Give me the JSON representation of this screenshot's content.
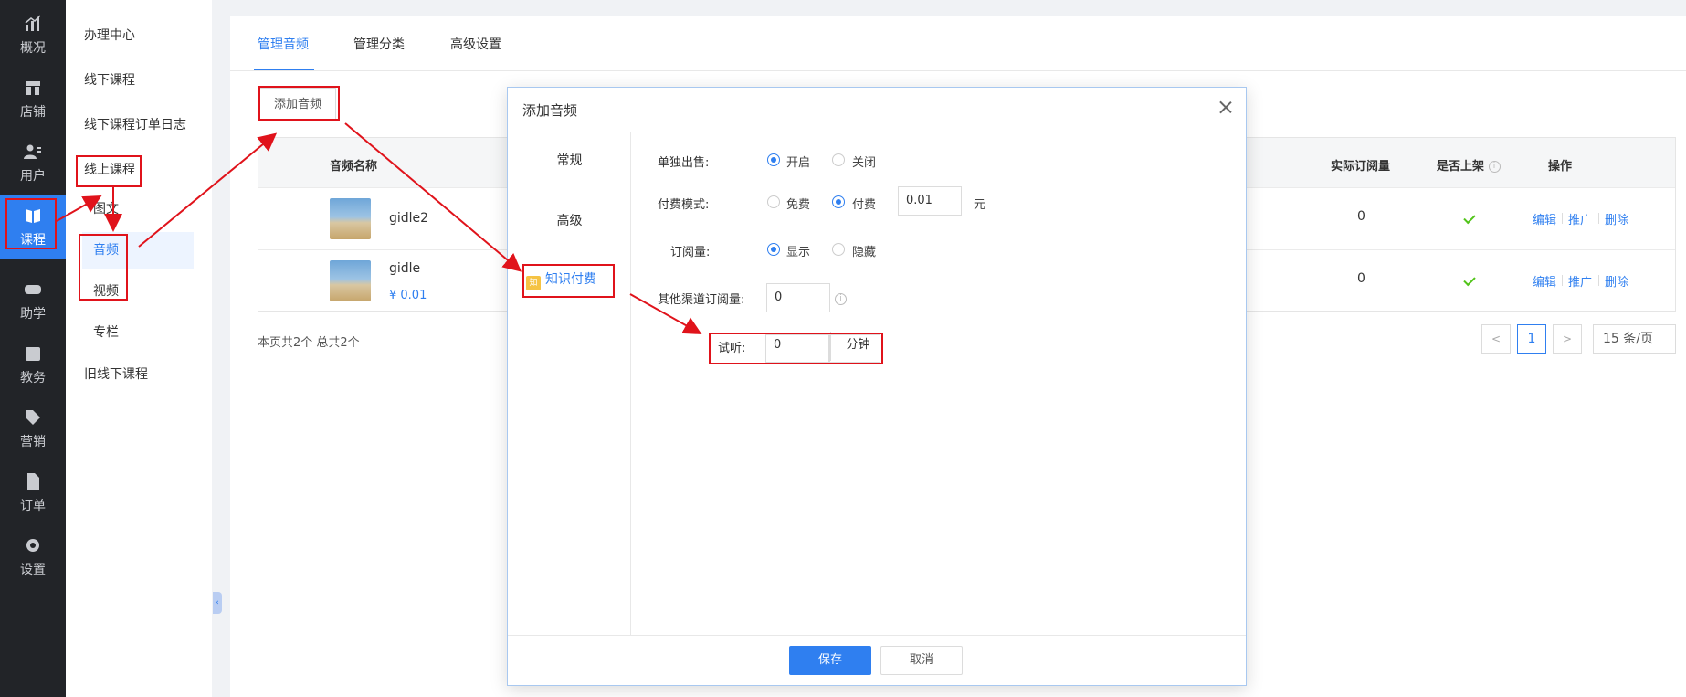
{
  "nav": {
    "items": [
      {
        "label": "概况",
        "icon": "chart-icon"
      },
      {
        "label": "店铺",
        "icon": "store-icon"
      },
      {
        "label": "用户",
        "icon": "users-icon"
      },
      {
        "label": "课程",
        "icon": "book-icon"
      },
      {
        "label": "助学",
        "icon": "gamepad-icon"
      },
      {
        "label": "教务",
        "icon": "calendar-icon"
      },
      {
        "label": "营销",
        "icon": "tag-icon"
      },
      {
        "label": "订单",
        "icon": "document-icon"
      },
      {
        "label": "设置",
        "icon": "gear-icon"
      }
    ],
    "active": "课程"
  },
  "sidebar": {
    "items": [
      "办理中心",
      "线下课程",
      "线下课程订单日志",
      "线上课程",
      "旧线下课程"
    ],
    "sub_items": [
      "图文",
      "音频",
      "视频",
      "专栏"
    ],
    "active_sub": "音频"
  },
  "tabs": [
    "管理音频",
    "管理分类",
    "高级设置"
  ],
  "toolbar": {
    "add_label": "添加音频"
  },
  "table": {
    "headers": {
      "name": "音频名称",
      "orders": "实际订阅量",
      "listed": "是否上架",
      "actions": "操作"
    },
    "rows": [
      {
        "name": "gidle2",
        "price": "",
        "orders": "0"
      },
      {
        "name": "gidle",
        "price": "¥ 0.01",
        "orders": "0"
      }
    ],
    "actions": [
      "编辑",
      "推广",
      "删除"
    ]
  },
  "pagination": {
    "summary": "本页共2个 总共2个",
    "current": "1",
    "page_size": "15 条/页"
  },
  "modal": {
    "title": "添加音频",
    "nav": [
      "常规",
      "高级",
      "知识付费"
    ],
    "active_nav": "知识付费",
    "kf_icon_text": "知",
    "form": {
      "sell_alone": {
        "label": "单独出售:",
        "options": [
          "开启",
          "关闭"
        ],
        "selected": "开启"
      },
      "pay_mode": {
        "label": "付费模式:",
        "options": [
          "免费",
          "付费"
        ],
        "selected": "付费",
        "price": "0.01",
        "unit": "元"
      },
      "subscription": {
        "label": "订阅量:",
        "options": [
          "显示",
          "隐藏"
        ],
        "selected": "显示"
      },
      "other_channel": {
        "label": "其他渠道订阅量:",
        "value": "0"
      },
      "trial": {
        "label": "试听:",
        "value": "0",
        "unit": "分钟"
      }
    },
    "save_label": "保存",
    "cancel_label": "取消"
  },
  "colors": {
    "accent": "#2f7ff0",
    "annotation": "#e0131b",
    "nav_bg": "#222428"
  }
}
